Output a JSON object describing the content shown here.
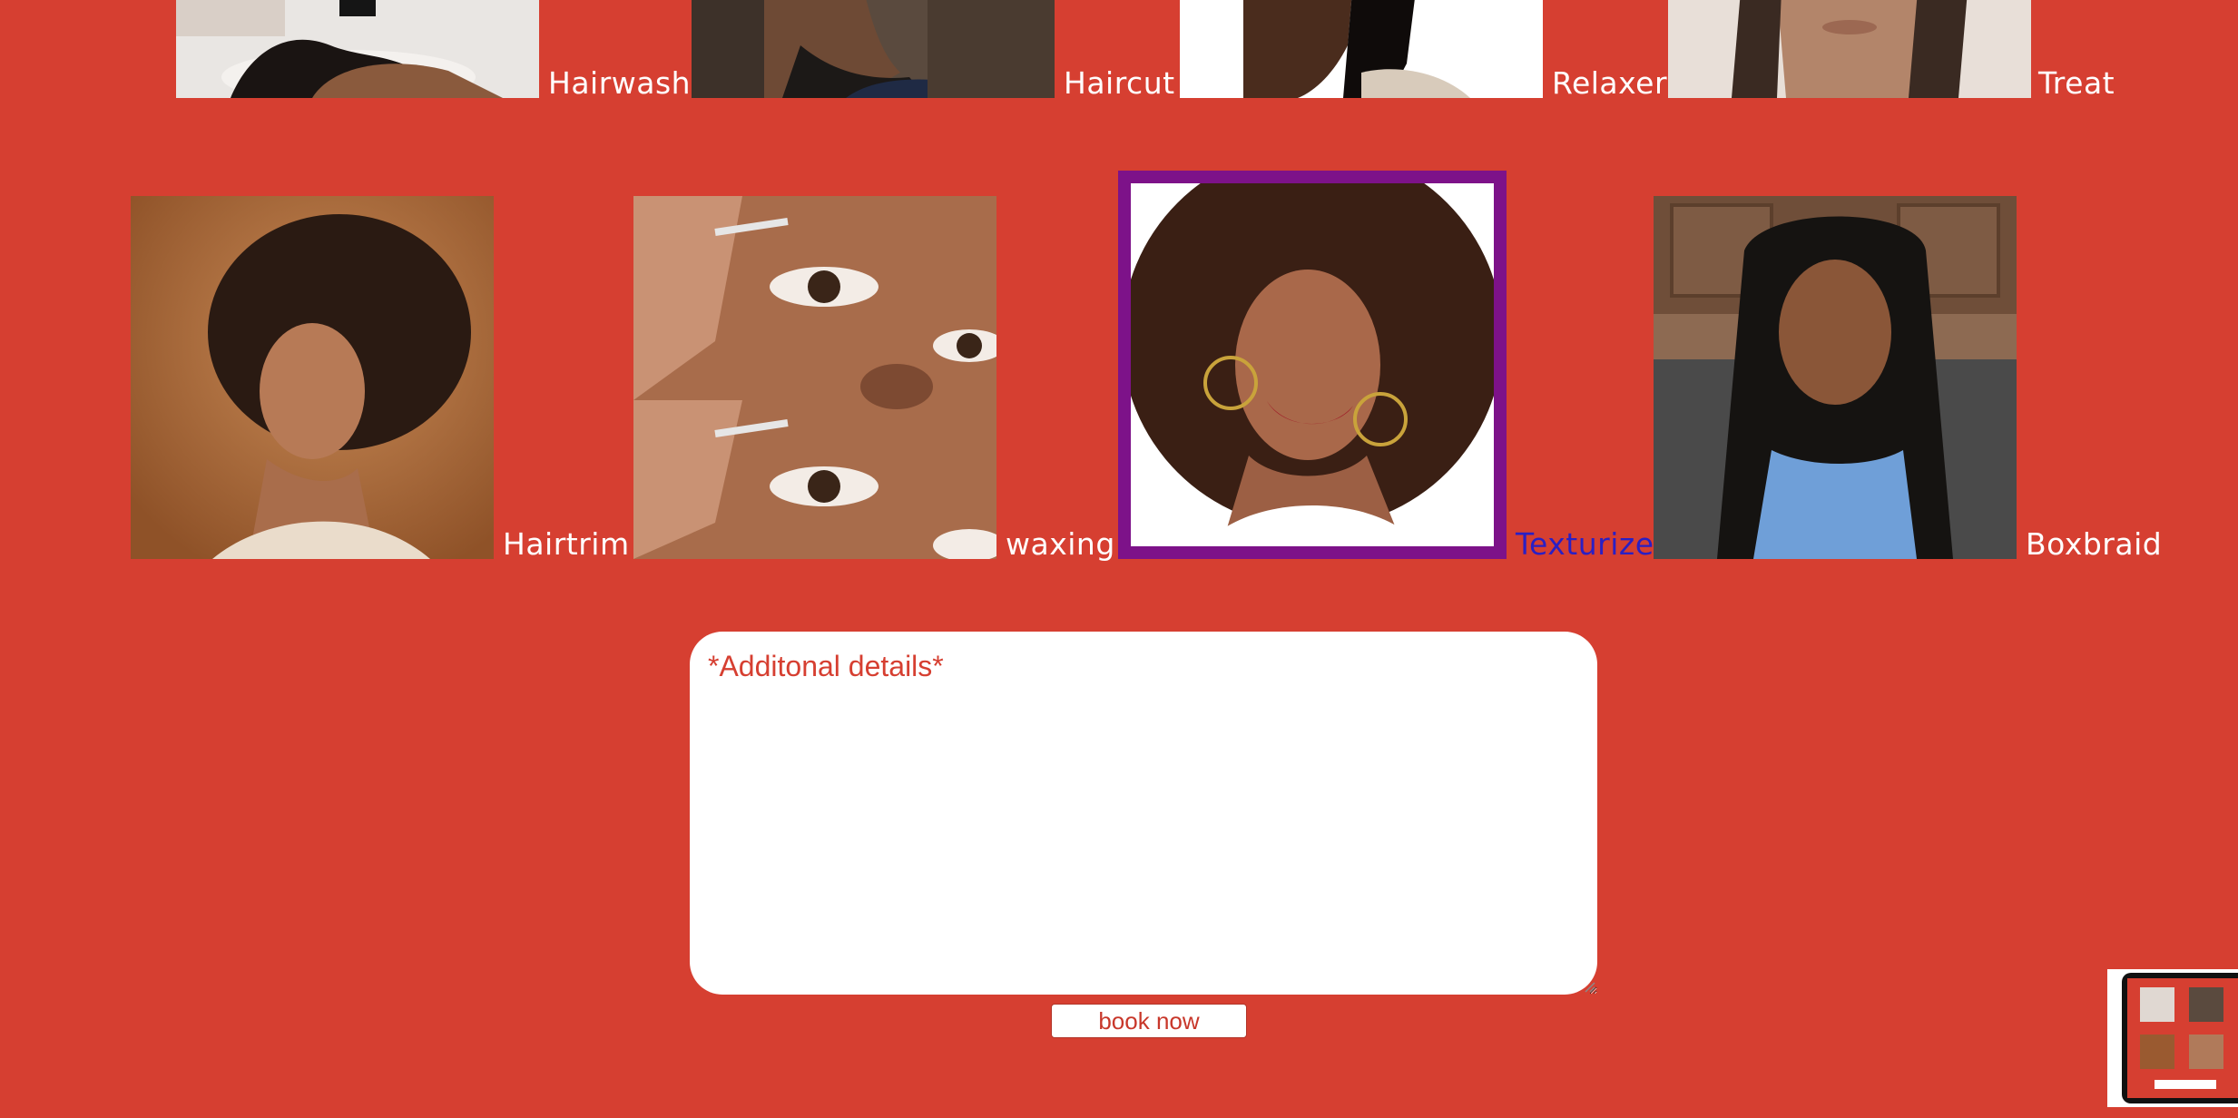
{
  "services_row1": [
    {
      "id": "hairwash",
      "label": "Hairwash"
    },
    {
      "id": "haircut",
      "label": "Haircut"
    },
    {
      "id": "relaxer",
      "label": "Relaxer"
    },
    {
      "id": "treat",
      "label": "Treat"
    }
  ],
  "services_row2": [
    {
      "id": "hairtrim",
      "label": "Hairtrim"
    },
    {
      "id": "waxing",
      "label": "waxing"
    },
    {
      "id": "texturize",
      "label": "Texturize"
    },
    {
      "id": "boxbraid",
      "label": "Boxbraid"
    }
  ],
  "selected_service": "Texturize",
  "details": {
    "placeholder": "*Additonal details*",
    "value": ""
  },
  "book_button": {
    "label": "book now"
  },
  "colors": {
    "background": "#d63f31",
    "selected_border": "#7d1289",
    "selected_label": "#2a1fc4",
    "label": "#ffffff"
  }
}
